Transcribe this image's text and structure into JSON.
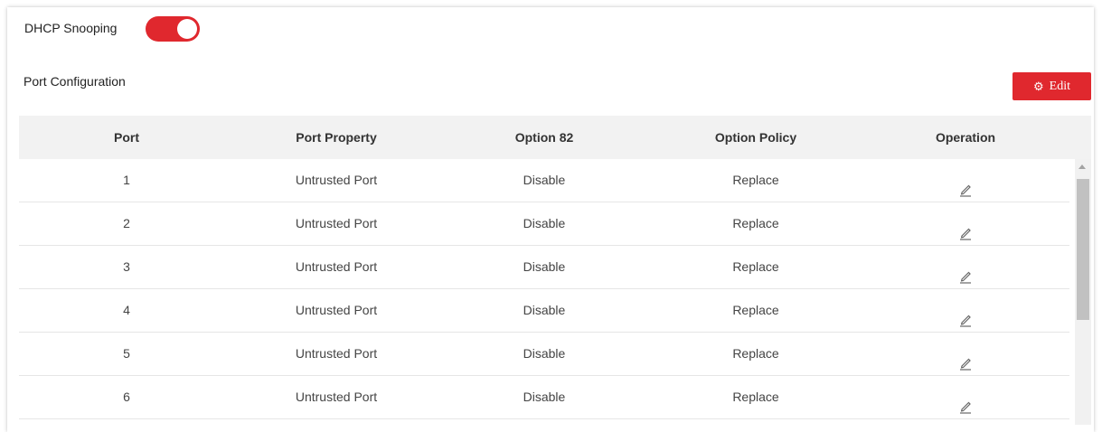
{
  "dhcp_snooping": {
    "label": "DHCP Snooping",
    "enabled": true,
    "color": "#e0282e"
  },
  "port_config": {
    "title": "Port Configuration",
    "edit_label": "Edit",
    "edit_icon": "gear-icon"
  },
  "table": {
    "headers": [
      "Port",
      "Port Property",
      "Option 82",
      "Option Policy",
      "Operation"
    ],
    "rows": [
      {
        "port": "1",
        "property": "Untrusted Port",
        "option82": "Disable",
        "policy": "Replace",
        "operation": "pencil-icon"
      },
      {
        "port": "2",
        "property": "Untrusted Port",
        "option82": "Disable",
        "policy": "Replace",
        "operation": "pencil-icon"
      },
      {
        "port": "3",
        "property": "Untrusted Port",
        "option82": "Disable",
        "policy": "Replace",
        "operation": "pencil-icon"
      },
      {
        "port": "4",
        "property": "Untrusted Port",
        "option82": "Disable",
        "policy": "Replace",
        "operation": "pencil-icon"
      },
      {
        "port": "5",
        "property": "Untrusted Port",
        "option82": "Disable",
        "policy": "Replace",
        "operation": "pencil-icon"
      },
      {
        "port": "6",
        "property": "Untrusted Port",
        "option82": "Disable",
        "policy": "Replace",
        "operation": "pencil-icon"
      }
    ]
  },
  "colors": {
    "accent": "#e0282e",
    "header_bg": "#f2f2f2"
  }
}
